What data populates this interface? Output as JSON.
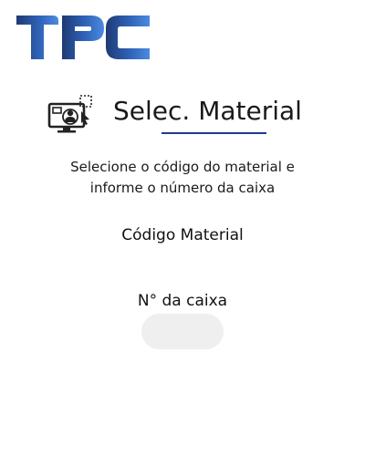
{
  "brand": {
    "logo_text": "TPC",
    "color_dark": "#1f3a73",
    "color_light": "#3d7bd6"
  },
  "header": {
    "icon": "monitor-user-icon",
    "title": "Selec. Material",
    "underline_color": "#1f3a8f"
  },
  "instructions": {
    "line1": "Selecione o código do material e",
    "line2": "informe o número da caixa"
  },
  "fields": {
    "codigo_material_label": "Código Material",
    "caixa_label": "N° da caixa",
    "caixa_value": ""
  }
}
